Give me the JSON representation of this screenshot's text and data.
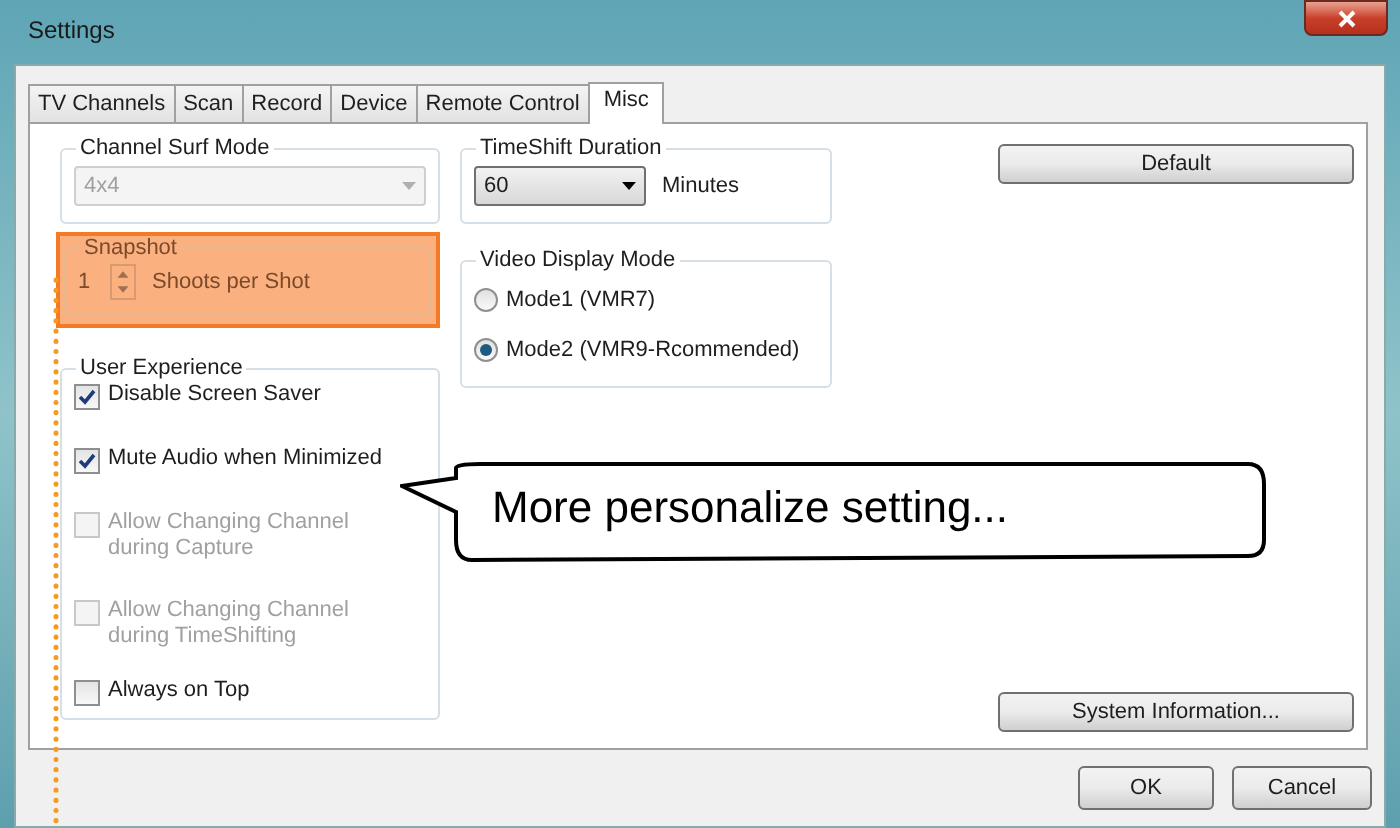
{
  "window": {
    "title": "Settings"
  },
  "tabs": [
    {
      "label": "TV Channels",
      "selected": false
    },
    {
      "label": "Scan",
      "selected": false
    },
    {
      "label": "Record",
      "selected": false
    },
    {
      "label": "Device",
      "selected": false
    },
    {
      "label": "Remote Control",
      "selected": false
    },
    {
      "label": "Misc",
      "selected": true
    }
  ],
  "channel_surf_mode": {
    "title": "Channel Surf Mode",
    "value": "4x4",
    "disabled": true
  },
  "snapshot": {
    "title": "Snapshot",
    "value": "1",
    "unit": "Shoots per Shot",
    "highlighted": true
  },
  "user_experience": {
    "title": "User Experience",
    "items": [
      {
        "label": "Disable Screen Saver",
        "checked": true,
        "disabled": false
      },
      {
        "label": "Mute Audio when Minimized",
        "checked": true,
        "disabled": false
      },
      {
        "label": "Allow Changing Channel during Capture",
        "checked": false,
        "disabled": true
      },
      {
        "label": "Allow Changing Channel during TimeShifting",
        "checked": false,
        "disabled": true
      },
      {
        "label": "Always on Top",
        "checked": false,
        "disabled": false
      }
    ]
  },
  "timeshift_duration": {
    "title": "TimeShift Duration",
    "value": "60",
    "unit": "Minutes"
  },
  "video_display_mode": {
    "title": "Video Display Mode",
    "options": [
      {
        "label": "Mode1 (VMR7)",
        "selected": false
      },
      {
        "label": "Mode2 (VMR9-Rcommended)",
        "selected": true
      }
    ]
  },
  "buttons": {
    "default": "Default",
    "system_information": "System Information...",
    "ok": "OK",
    "cancel": "Cancel"
  },
  "callout": {
    "text": "More personalize setting..."
  }
}
